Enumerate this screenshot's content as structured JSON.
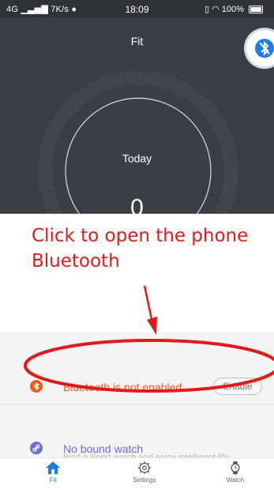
{
  "status_bar": {
    "network": "4G",
    "speed": "7K/s",
    "time": "18:09",
    "battery": "100%"
  },
  "header": {
    "title": "Fit"
  },
  "dial": {
    "label": "Today",
    "value": "0"
  },
  "annotation": {
    "line1": "Click to open the phone",
    "line2": "Bluetooth"
  },
  "bluetooth_row": {
    "message": "Bluetooth is not enabled",
    "enable_label": "Enable"
  },
  "watch_row": {
    "message": "No bound watch",
    "sub_text": "Bind a Soprt watch and enjoy intelligent life"
  },
  "tabs": [
    {
      "label": "Fit",
      "icon": "home-icon",
      "active": true
    },
    {
      "label": "Settings",
      "icon": "gear-icon",
      "active": false
    },
    {
      "label": "Watch",
      "icon": "watch-icon",
      "active": false
    }
  ],
  "colors": {
    "accent_blue": "#1e7ce8",
    "warning_orange": "#f25a1c",
    "annotation_red": "#e01b1b",
    "watch_purple": "#6e6ad8",
    "dark_bg": "#3a3f45"
  }
}
